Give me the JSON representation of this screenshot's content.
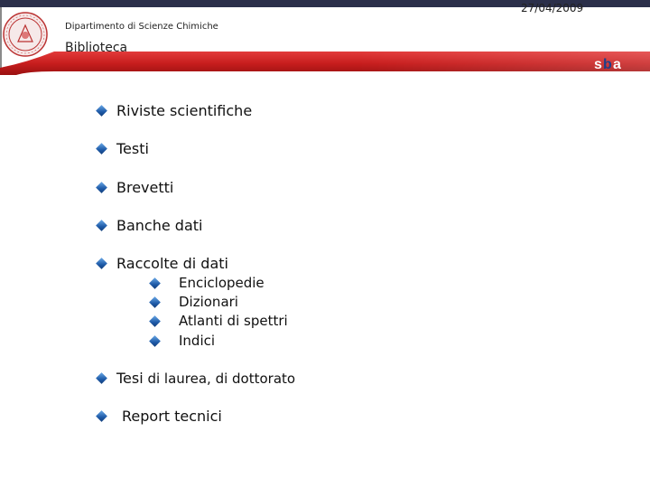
{
  "header": {
    "department": "Dipartimento di Scienze Chimiche",
    "title": "Biblioteca",
    "date": "27/04/2009",
    "logo_text": "sba",
    "seal_icon": "university-seal-icon"
  },
  "colors": {
    "accent_red": "#c81e1e",
    "bullet_blue": "#1e5aa8",
    "top_bar": "#2b2f4a"
  },
  "list": {
    "items": [
      {
        "label": "Riviste scientifiche"
      },
      {
        "label": "Testi"
      },
      {
        "label": "Brevetti"
      },
      {
        "label": "Banche dati"
      },
      {
        "label": "Raccolte di dati",
        "children": [
          "Enciclopedie",
          "Dizionari",
          "Atlanti di spettri",
          "Indici"
        ]
      },
      {
        "label_bold": "Tesi",
        "label_rest": " di laurea, di dottorato"
      },
      {
        "label": "Report tecnici"
      }
    ]
  }
}
